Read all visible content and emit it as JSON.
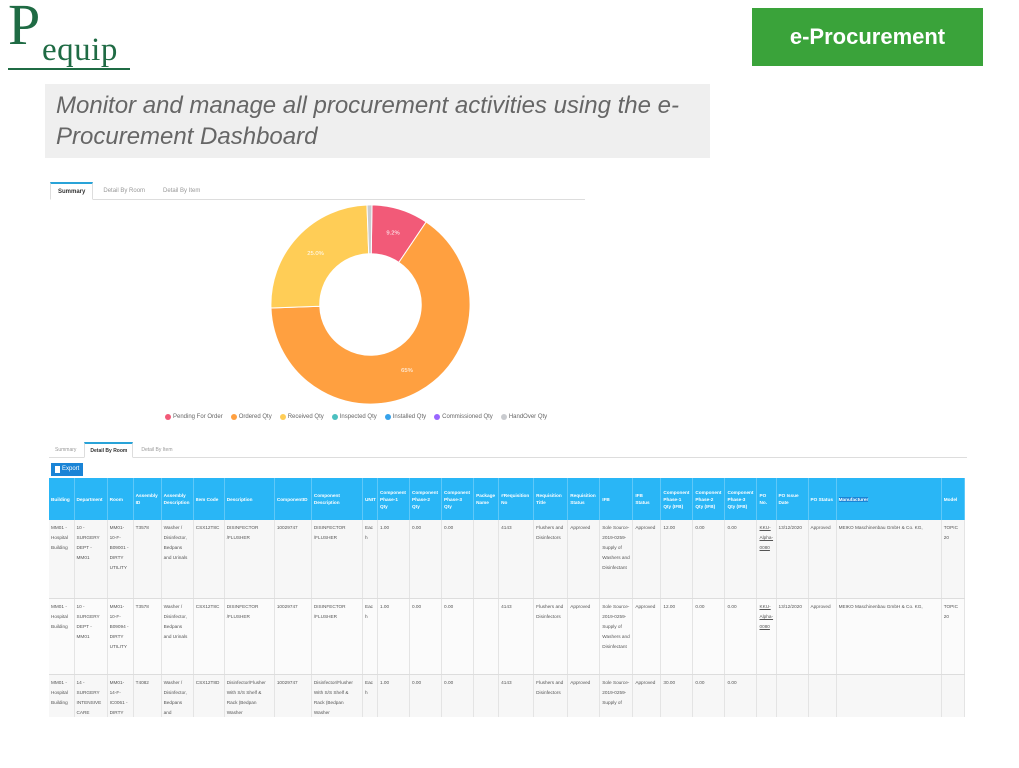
{
  "header": {
    "logo_initial": "P",
    "logo_rest": "equip",
    "badge": "e-Procurement",
    "subtitle": "Monitor and manage all procurement activities using the e-Procurement Dashboard"
  },
  "summary": {
    "tabs": [
      "Summary",
      "Detail By Room",
      "Detail By Item"
    ],
    "active_tab": 0
  },
  "chart_data": {
    "type": "pie",
    "donut": true,
    "categories": [
      "Pending For Order",
      "Ordered Qty",
      "Received Qty",
      "Inspected Qty",
      "Installed Qty",
      "Commissioned Qty",
      "HandOver Qty"
    ],
    "values": [
      9.2,
      65,
      25.0,
      0,
      0,
      0,
      0.8
    ],
    "slice_labels": [
      "9.2%",
      "65%",
      "25.0%",
      "",
      "",
      "",
      ""
    ],
    "colors": [
      "#f25a78",
      "#ffa040",
      "#ffcd56",
      "#4bc0c0",
      "#36a2eb",
      "#9966ff",
      "#c9cbcf"
    ],
    "legend_position": "bottom"
  },
  "detail": {
    "tabs": [
      "Summary",
      "Detail By Room",
      "Detail By Item"
    ],
    "active_tab": 1,
    "export_label": "Export",
    "columns": [
      "Building",
      "Department",
      "Room",
      "Assembly ID",
      "Assembly Description",
      "Item Code",
      "Description",
      "ComponentID",
      "Component Description",
      "UNIT",
      "Component Phase-1 Qty",
      "Component Phase-2 Qty",
      "Component Phase-3 Qty",
      "Package Name",
      "#Requisition No",
      "Requisition Title",
      "Requisition Status",
      "IFB",
      "IFB Status",
      "Component Phase-1 Qty (IFB)",
      "Component Phase-2 Qty (IFB)",
      "Component Phase-3 Qty (IFB)",
      "PO No.",
      "PO Issue Date",
      "PO Status",
      "Manufacturer",
      "Model"
    ],
    "rows": [
      [
        "MM01 - Hospital Building",
        "10 - SURGERY DEPT - MM01",
        "MM01-10-F-B09001 - DIRTY UTILITY",
        "T3578",
        "Washer / Disinfector, Bedpans and Urinals",
        "CSX12T8C",
        "DISINFECTOR /FLUSHER",
        "10029747",
        "DISINFECTOR /FLUSHER",
        "Each",
        "1.00",
        "0.00",
        "0.00",
        "",
        "4143",
        "Flushers and Disinfectors",
        "Approved",
        "Sole Source-2019-0259-Supply of Washers and Disinfectant",
        "Approved",
        "12.00",
        "0.00",
        "0.00",
        "KKU-Alpha-0080",
        "13/12/2020",
        "Approved",
        "MEIKO Maschinenbau GmbH & Co. KG,",
        "TOPIC 20"
      ],
      [
        "MM01 - Hospital Building",
        "10 - SURGERY DEPT - MM01",
        "MM01-10-F-B09094 - DIRTY UTILITY",
        "T3578",
        "Washer / Disinfector, Bedpans and Urinals",
        "CSX12T8C",
        "DISINFECTOR /FLUSHER",
        "10029747",
        "DISINFECTOR /FLUSHER",
        "Each",
        "1.00",
        "0.00",
        "0.00",
        "",
        "4143",
        "Flushers and Disinfectors",
        "Approved",
        "Sole Source-2019-0259-Supply of Washers and Disinfectant",
        "Approved",
        "12.00",
        "0.00",
        "0.00",
        "KKU-Alpha-0080",
        "13/12/2020",
        "Approved",
        "MEIKO Maschinenbau GmbH & Co. KG,",
        "TOPIC 20"
      ],
      [
        "MM01 - Hospital Building",
        "14 - SURGERY INTENSIVE CARE",
        "MM01-14-F-IC0061 - DIRTY",
        "T4082",
        "Washer / Disinfector, Bedpans and",
        "CSX12T8D",
        "Disinfector/Flusher With S/S Shelf & Rack (Bedpan Washer",
        "10029747",
        "Disinfector/Flusher With S/S Shelf & Rack (Bedpan Washer",
        "Each",
        "1.00",
        "0.00",
        "0.00",
        "",
        "4143",
        "Flushers and Disinfectors",
        "Approved",
        "Sole Source-2019-0259-Supply of",
        "Approved",
        "30.00",
        "0.00",
        "0.00",
        "",
        "",
        "",
        "",
        ""
      ]
    ]
  }
}
